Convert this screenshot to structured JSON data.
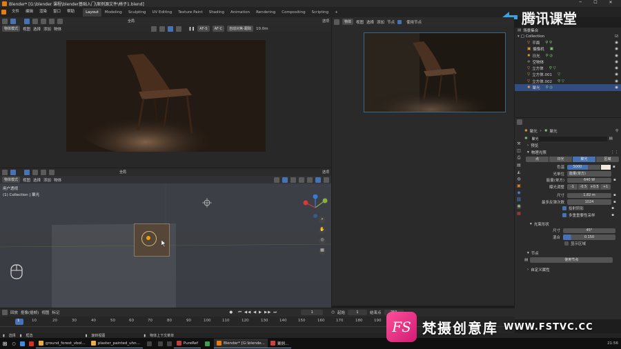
{
  "window": {
    "title": "Blender* [G:\\blender   课程\\blender基础入门\\案例源文件\\椅子1.blend]"
  },
  "menu": [
    "文件",
    "编辑",
    "渲染",
    "窗口",
    "帮助"
  ],
  "workspaces": [
    "Layout",
    "Modeling",
    "Sculpting",
    "UV Editing",
    "Texture Paint",
    "Shading",
    "Animation",
    "Rendering",
    "Compositing",
    "Scripting"
  ],
  "active_workspace": "Layout",
  "watermark_top": {
    "text": "腾讯课堂"
  },
  "viewport_top": {
    "mode": "物体模式",
    "menus": [
      "视图",
      "选择",
      "添加",
      "物体"
    ],
    "transform": "全局",
    "af_labels": [
      "AF-S",
      "AF-C"
    ],
    "auto_focus": "自动对焦-跟踪",
    "distance": "10.0m",
    "options": "选项"
  },
  "viewport_bottom": {
    "mode": "物体模式",
    "menus": [
      "视图",
      "选择",
      "添加",
      "物体"
    ],
    "transform": "全局",
    "options": "选项",
    "view_name": "用户透视",
    "collection_info": "(1) Collection | 聚光"
  },
  "render_view": {
    "type": "物体",
    "menus": [
      "视图",
      "选择",
      "添加",
      "节点"
    ],
    "use_nodes": "使用节点"
  },
  "outliner": {
    "scene_collection": "场景集合",
    "collection": "Collection",
    "items": [
      "平面",
      "摄像机",
      "日光",
      "空物体",
      "立方体",
      "立方体.001",
      "立方体.002",
      "聚光"
    ]
  },
  "properties": {
    "object_name": "聚光",
    "light_name": "聚光",
    "data_name": "聚光",
    "preview": "预览",
    "section_light": "物理光照",
    "light_types": [
      "点",
      "日光",
      "聚光",
      "区域"
    ],
    "active_light_type": "聚光",
    "color_label": "色温",
    "color_value": "5000",
    "unit_label": "光单位",
    "unit_value": "能量(单方)",
    "power_label": "能量(单方)",
    "power_value": "640 W",
    "exposure_label": "曝光调整",
    "exposure_buttons": [
      "-1",
      "-0.5",
      "+0.5",
      "+1"
    ],
    "size_label": "尺寸",
    "size_value": "1.82 m",
    "bounces_label": "最多反弹次数",
    "bounces_value": "1024",
    "cast_shadow": "投射阴影",
    "multi_importance": "多重重要性采样",
    "spot_section": "光束形状",
    "spot_size_label": "尺寸",
    "spot_size_value": "45°",
    "blend_label": "混合",
    "blend_value": "0.150",
    "show_cone": "显示区域",
    "nodes_section": "节点",
    "use_nodes_button": "使用节点",
    "custom_props": "自定义属性"
  },
  "timeline": {
    "menus": [
      "回放",
      "抠像(插帧)",
      "视图",
      "标记"
    ],
    "current_frame": "1",
    "start_label": "起始",
    "start": "1",
    "end_label": "结束点",
    "end": "250",
    "ticks": [
      "1",
      "10",
      "20",
      "30",
      "40",
      "50",
      "60",
      "70",
      "80",
      "90",
      "100",
      "110",
      "120",
      "130",
      "140",
      "150",
      "160",
      "170",
      "180",
      "190"
    ]
  },
  "statusbar": {
    "select": "选择",
    "box": "框选",
    "rotate": "旋转视图",
    "context": "物体上下文菜单"
  },
  "taskbar": {
    "items": [
      "ground_forest_vbol...",
      "plaster_painted_uhn...",
      "PureRef",
      "Blender* [G:\\blende...",
      "案例..."
    ],
    "clock": "21:56"
  },
  "watermark_bottom": {
    "logo": "FS",
    "text": "梵摄创意库",
    "url": "WWW.FSTVC.CC"
  },
  "colors": {
    "accent": "#4772b3",
    "panel": "#282828",
    "header": "#2d2d2d",
    "origin_select": "#f0a000"
  }
}
